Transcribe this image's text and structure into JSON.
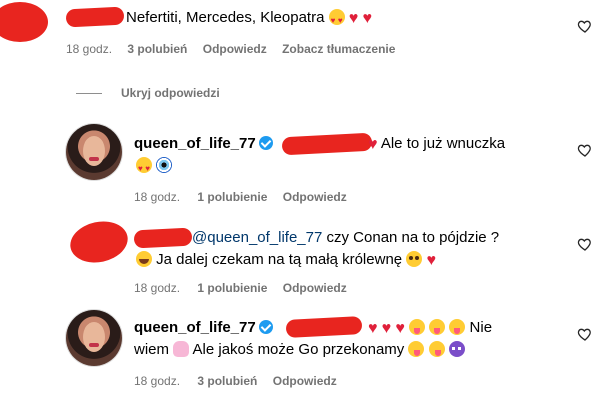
{
  "comments": [
    {
      "text": "Nefertiti, Mercedes, Kleopatra",
      "time": "18 godz.",
      "likes": "3 polubień",
      "reply": "Odpowiedz",
      "translate": "Zobacz tłumaczenie",
      "emojis": [
        "heart-eyes",
        "heart",
        "heart"
      ]
    }
  ],
  "replies_toggle": {
    "label": "Ukryj odpowiedzi"
  },
  "replies": [
    {
      "username": "queen_of_life_77",
      "verified": true,
      "text": "Ale to już wnuczka",
      "time": "18 godz.",
      "likes": "1 polubienie",
      "reply": "Odpowiedz"
    },
    {
      "mention": "@queen_of_life_77",
      "text_line1": "czy Conan na to pójdzie ?",
      "text_line2": "Ja dalej czekam na tą małą królewnę",
      "time": "18 godz.",
      "likes": "1 polubienie",
      "reply": "Odpowiedz"
    },
    {
      "username": "queen_of_life_77",
      "verified": true,
      "text_line1_end": "Nie",
      "text_line2": "wiem",
      "text_line2_b": "Ale jakoś może Go przekonamy",
      "time": "18 godz.",
      "likes": "3 polubień",
      "reply": "Odpowiedz"
    }
  ],
  "colors": {
    "redaction": "#e8251f",
    "mention": "#00376b",
    "meta": "#737373",
    "heart": "#e0203a"
  }
}
